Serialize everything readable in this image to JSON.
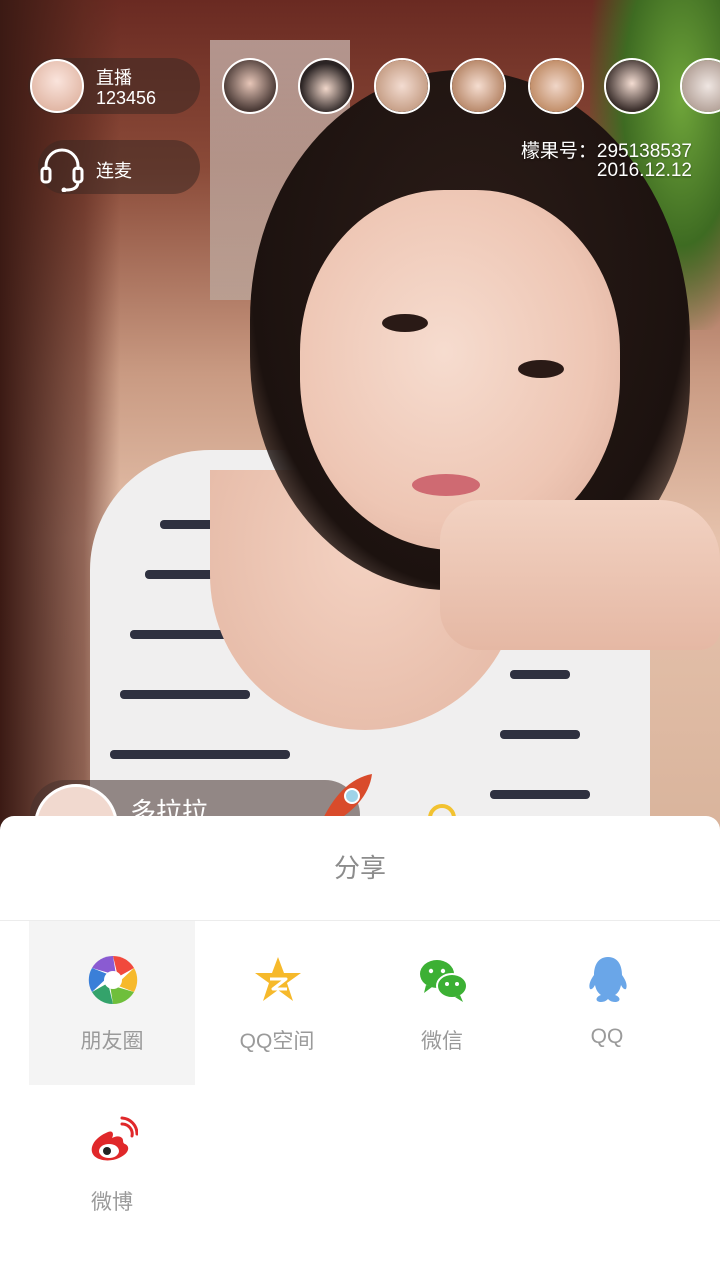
{
  "live": {
    "host_title": "直播",
    "host_id": "123456",
    "mic_label": "连麦",
    "account_line": "檬果号：295138537",
    "date": "2016.12.12",
    "bottom_user_name": "多拉拉",
    "viewers": [
      "viewer-1",
      "viewer-2",
      "viewer-3",
      "viewer-4",
      "viewer-5",
      "viewer-6",
      "viewer-7"
    ]
  },
  "share": {
    "title": "分享",
    "items": [
      {
        "label": "朋友圈",
        "icon": "moments-icon"
      },
      {
        "label": "QQ空间",
        "icon": "qzone-icon"
      },
      {
        "label": "微信",
        "icon": "wechat-icon"
      },
      {
        "label": "QQ",
        "icon": "qq-icon"
      },
      {
        "label": "微博",
        "icon": "weibo-icon"
      }
    ]
  },
  "colors": {
    "wechat": "#3CB034",
    "qq": "#6AA6E8",
    "weibo": "#E0282A",
    "qzone": "#F6B92B",
    "sheet_text": "#9A9A9A"
  }
}
